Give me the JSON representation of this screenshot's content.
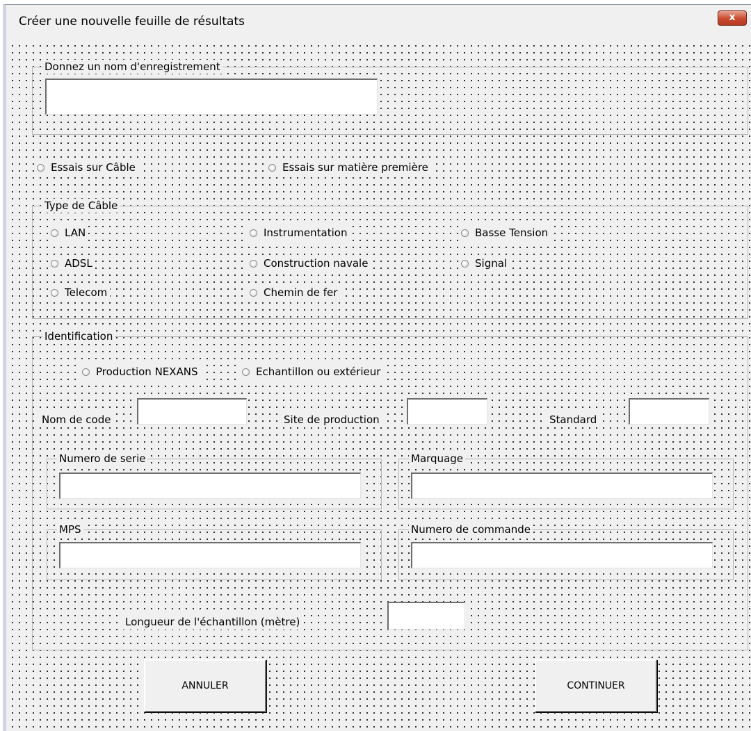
{
  "window": {
    "title": "Créer une nouvelle feuille de résultats",
    "close_label": "x"
  },
  "name_group": {
    "legend": "Donnez un nom d'enregistrement",
    "input_value": ""
  },
  "test_type": {
    "options": [
      {
        "label": "Essais sur Câble",
        "selected": false
      },
      {
        "label": "Essais sur matière première",
        "selected": false
      }
    ]
  },
  "cable_type": {
    "legend": "Type de Câble",
    "options": [
      {
        "label": "LAN",
        "selected": false
      },
      {
        "label": "ADSL",
        "selected": false
      },
      {
        "label": "Telecom",
        "selected": false
      },
      {
        "label": "Instrumentation",
        "selected": false
      },
      {
        "label": "Construction navale",
        "selected": false
      },
      {
        "label": "Chemin de fer",
        "selected": false
      },
      {
        "label": "Basse Tension",
        "selected": false
      },
      {
        "label": "Signal",
        "selected": false
      }
    ]
  },
  "identification": {
    "legend": "Identification",
    "source_options": [
      {
        "label": "Production NEXANS",
        "selected": false
      },
      {
        "label": "Echantillon ou extérieur",
        "selected": false
      }
    ],
    "fields": {
      "code_name_label": "Nom de code",
      "site_label": "Site de production",
      "standard_label": "Standard",
      "code_name_value": "",
      "site_value": "",
      "standard_value": ""
    },
    "serial": {
      "legend": "Numero de serie",
      "value": ""
    },
    "marking": {
      "legend": "Marquage",
      "value": ""
    },
    "mps": {
      "legend": "MPS",
      "value": ""
    },
    "order": {
      "legend": "Numero de commande",
      "value": ""
    },
    "length": {
      "label": "Longueur de l'échantillon (mètre)",
      "value": ""
    }
  },
  "buttons": {
    "cancel_label": "ANNULER",
    "continue_label": "CONTINUER"
  },
  "colors": {
    "dialog_bg": "#f0f0f0",
    "close_button": "#c94a2f",
    "grid_dots": "#000000"
  }
}
